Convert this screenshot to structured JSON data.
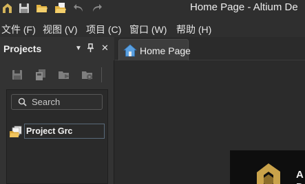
{
  "titlebar": {
    "title": "Home Page - Altium De",
    "icons": [
      "altium-logo-icon",
      "save-icon",
      "open-folder-icon",
      "open-project-icon",
      "undo-icon",
      "redo-icon"
    ]
  },
  "menubar": {
    "items": [
      "文件 (F)",
      "视图 (V)",
      "项目 (C)",
      "窗口 (W)",
      "帮助 (H)"
    ]
  },
  "panel": {
    "title": "Projects",
    "controls": {
      "dropdown": "▼",
      "pin": "ꟷ",
      "close": "✕"
    },
    "toolbar_icons": [
      "save-icon",
      "save-all-icon",
      "open-project-icon",
      "project-options-icon"
    ],
    "search_placeholder": "Search",
    "tree": [
      {
        "label": "Project Grc",
        "icon": "project-group-icon",
        "editing": true
      }
    ]
  },
  "tabs": [
    {
      "label": "Home Page",
      "icon": "home-icon",
      "active": true
    }
  ],
  "splash": {
    "letters": [
      "A",
      "D"
    ],
    "colors": {
      "logo_gold": "#c9a24a",
      "background": "#0e0e0e"
    }
  }
}
